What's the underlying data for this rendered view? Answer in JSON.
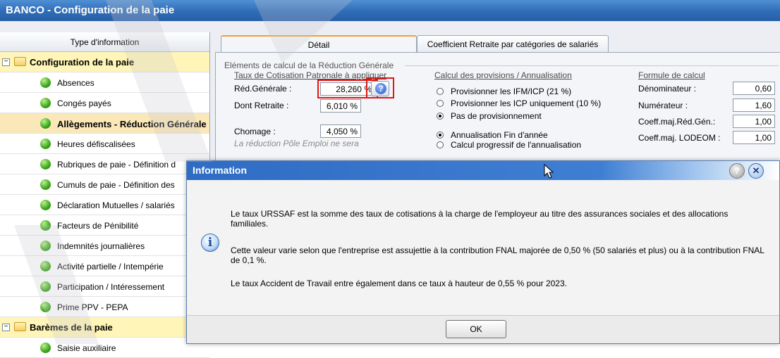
{
  "window": {
    "title": "BANCO - Configuration de la paie"
  },
  "tree": {
    "header": "Type d'information",
    "rows": [
      {
        "kind": "group",
        "label": "Configuration de la paie"
      },
      {
        "kind": "item",
        "label": "Absences"
      },
      {
        "kind": "item",
        "label": "Congés payés"
      },
      {
        "kind": "selected",
        "label": "Allègements - Réduction Générale"
      },
      {
        "kind": "item",
        "label": "Heures défiscalisées"
      },
      {
        "kind": "item",
        "label": "Rubriques de paie - Définition d"
      },
      {
        "kind": "item",
        "label": "Cumuls de paie - Définition des"
      },
      {
        "kind": "item",
        "label": "Déclaration Mutuelles / salariés"
      },
      {
        "kind": "item",
        "label": "Facteurs de Pénibilité"
      },
      {
        "kind": "item",
        "label": "Indemnités journalières"
      },
      {
        "kind": "item",
        "label": "Activité partielle / Intempérie"
      },
      {
        "kind": "item",
        "label": "Participation / Intéressement"
      },
      {
        "kind": "item",
        "label": "Prime PPV - PEPA"
      },
      {
        "kind": "group",
        "label": "Barèmes de la paie"
      },
      {
        "kind": "item",
        "label": "Saisie auxiliaire"
      }
    ]
  },
  "tabs": {
    "detail": "Détail",
    "coefficient": "Coefficient Retraite par catégories de salariés"
  },
  "detail": {
    "section_title": "Eléments de calcul de la Réduction Générale",
    "taux_heading": "Taux de Cotisation Patronale à appliquer",
    "red_generale_label": "Réd.Générale :",
    "red_generale_value": "28,260 %",
    "dont_retraite_label": "Dont Retraite :",
    "dont_retraite_value": "6,010 %",
    "chomage_label": "Chomage :",
    "chomage_value": "4,050 %",
    "chomage_note": "La réduction Pôle Emploi ne sera",
    "provisions_heading": "Calcul des provisions / Annualisation",
    "prov_option1": "Provisionner les IFM/ICP (21 %)",
    "prov_option2": "Provisionner les ICP uniquement (10 %)",
    "prov_option3": "Pas de provisionnement",
    "annual_option1": "Annualisation Fin d'année",
    "annual_option2": "Calcul progressif de l'annualisation",
    "formule_heading": "Formule de calcul",
    "denominateur_label": "Dénominateur :",
    "denominateur_value": "0,60",
    "numerateur_label": "Numérateur :",
    "numerateur_value": "1,60",
    "coeff_red_label": "Coeff.maj.Réd.Gén.:",
    "coeff_red_value": "1,00",
    "coeff_lodeom_label": "Coeff.maj. LODEOM :",
    "coeff_lodeom_value": "1,00"
  },
  "dialog": {
    "title": "Information",
    "message1": "Le taux URSSAF est la somme des taux de cotisations à la charge de l'employeur au titre des assurances sociales et des allocations familiales.",
    "message2": "Cette valeur varie selon que l'entreprise est assujettie à la contribution FNAL majorée de 0,50 % (50 salariés et plus) ou à la contribution FNAL de 0,1 %.",
    "message3": "Le taux Accident de Travail entre également dans ce taux à hauteur de 0,55 % pour 2023.",
    "ok_label": "OK"
  },
  "colors": {
    "titlebar": "#2f6cb8",
    "highlight_red": "#e01818",
    "group_row": "#fff5b8"
  },
  "icons": {
    "help": "help-icon",
    "close": "close-icon",
    "info": "info-icon",
    "folder": "folder-icon",
    "status": "green-ball-icon"
  }
}
